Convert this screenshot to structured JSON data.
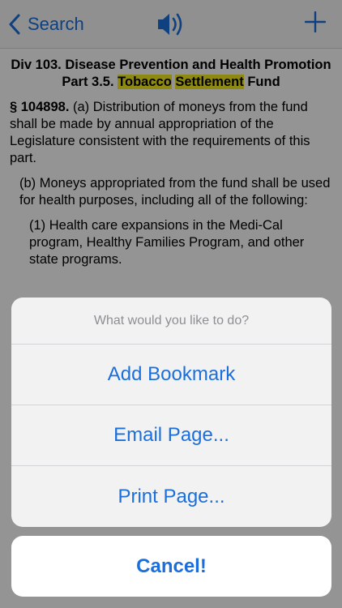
{
  "navbar": {
    "back_label": "Search",
    "speaker_icon": "speaker-icon",
    "add_icon": "plus-icon",
    "accent_color": "#1a6fdc"
  },
  "document": {
    "heading_line1": "Div 103. Disease Prevention and Health Promotion",
    "heading_part_prefix": "Part 3.5.",
    "heading_highlight1": "Tobacco",
    "heading_highlight2": "Settlement",
    "heading_suffix": "Fund",
    "section_number": "§ 104898.",
    "section_a": "(a) Distribution of moneys from the fund shall be made by annual appropriation of the Legislature consistent with the requirements of this part.",
    "section_b": "(b) Moneys appropriated from the fund shall be used for health purposes, including all of the following:",
    "section_b1": "(1) Health care expansions in the Medi-Cal program, Healthy Families Program, and other state programs.",
    "highlight_color": "#f5ee1e"
  },
  "action_sheet": {
    "title": "What would you like to do?",
    "options": [
      "Add Bookmark",
      "Email Page...",
      "Print Page..."
    ],
    "cancel_label": "Cancel!"
  }
}
